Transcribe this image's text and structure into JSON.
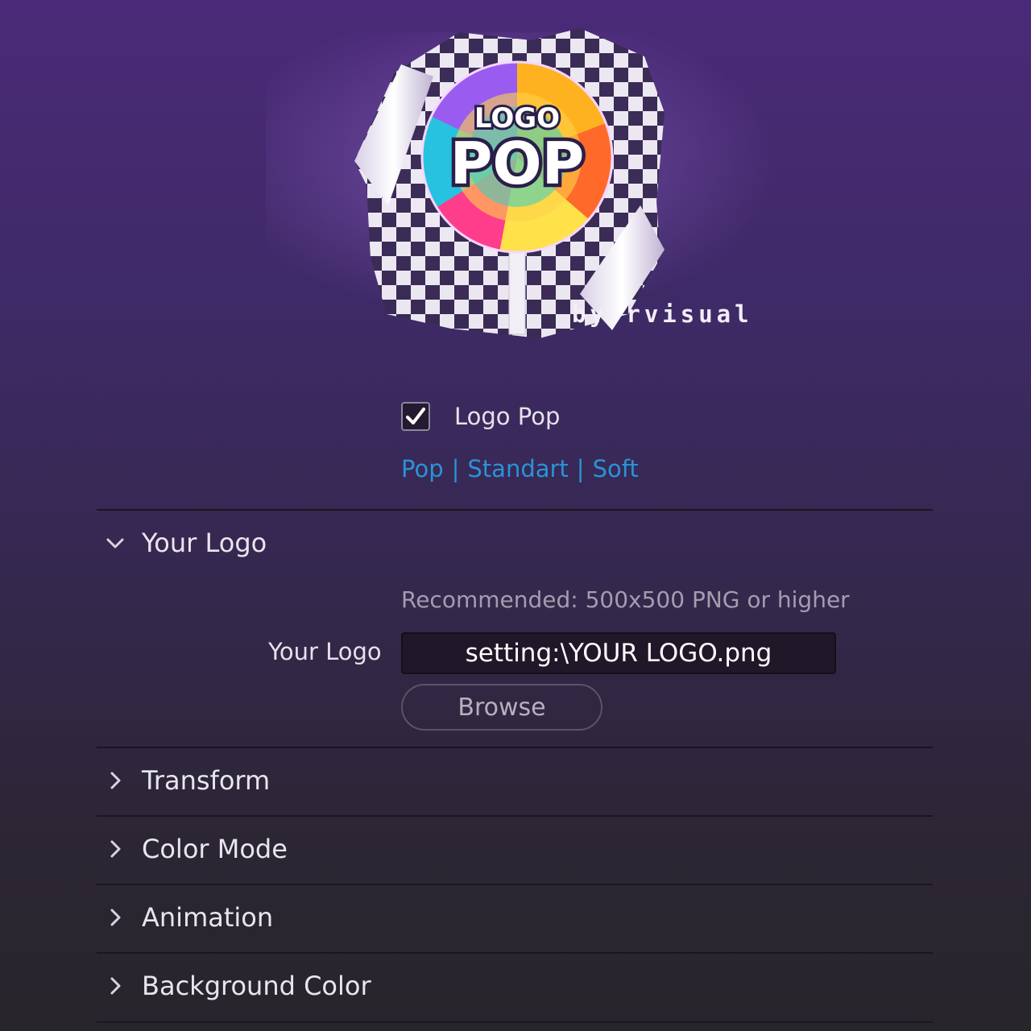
{
  "brand": {
    "logo_top": "LOGO",
    "logo_main": "POP",
    "byline": "by rvisual"
  },
  "toggle": {
    "checked": true,
    "label": "Logo Pop"
  },
  "presets": {
    "items": [
      "Pop",
      "Standart",
      "Soft"
    ],
    "separator": "|"
  },
  "sections": {
    "your_logo": {
      "title": "Your Logo",
      "expanded": true,
      "hint": "Recommended: 500x500 PNG or higher",
      "field_label": "Your Logo",
      "field_value": "setting:\\YOUR LOGO.png",
      "browse_label": "Browse"
    },
    "transform": {
      "title": "Transform",
      "expanded": false
    },
    "color_mode": {
      "title": "Color Mode",
      "expanded": false
    },
    "animation": {
      "title": "Animation",
      "expanded": false
    },
    "background_color": {
      "title": "Background Color",
      "expanded": false
    }
  },
  "colors": {
    "accent_link": "#2a93d5",
    "bg_top": "#4a2a78",
    "bg_bottom": "#28252b"
  },
  "icons": {
    "expanded": "chevron-down-icon",
    "collapsed": "chevron-right-icon",
    "check": "checkmark-icon"
  }
}
